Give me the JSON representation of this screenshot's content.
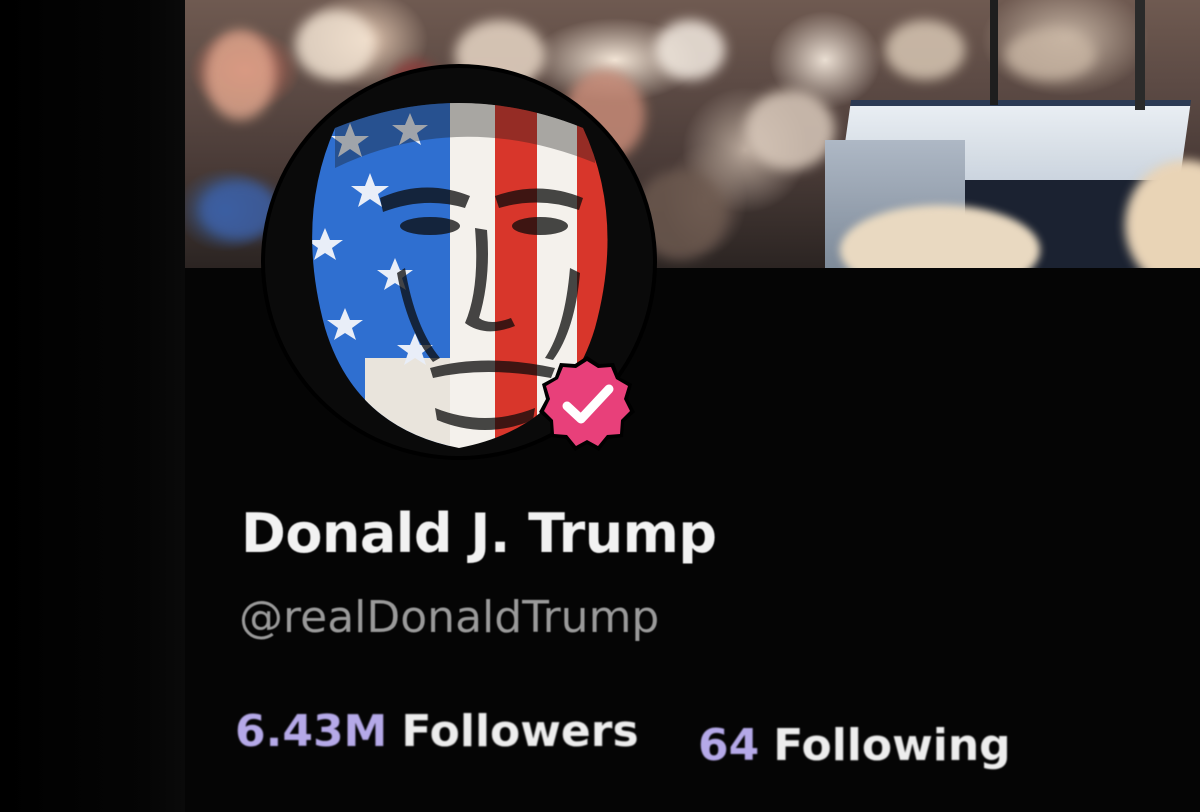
{
  "profile": {
    "display_name": "Donald J. Trump",
    "handle": "@realDonaldTrump",
    "verified_badge": "verified-check-icon",
    "badge_color": "#e8407a"
  },
  "stats": {
    "followers_count": "6.43M",
    "followers_label": "Followers",
    "following_count": "64",
    "following_label": "Following"
  },
  "colors": {
    "background": "#050505",
    "name_text": "#f2f2f2",
    "handle_text": "#9a9a9a",
    "stat_number": "#b5a9e8"
  }
}
